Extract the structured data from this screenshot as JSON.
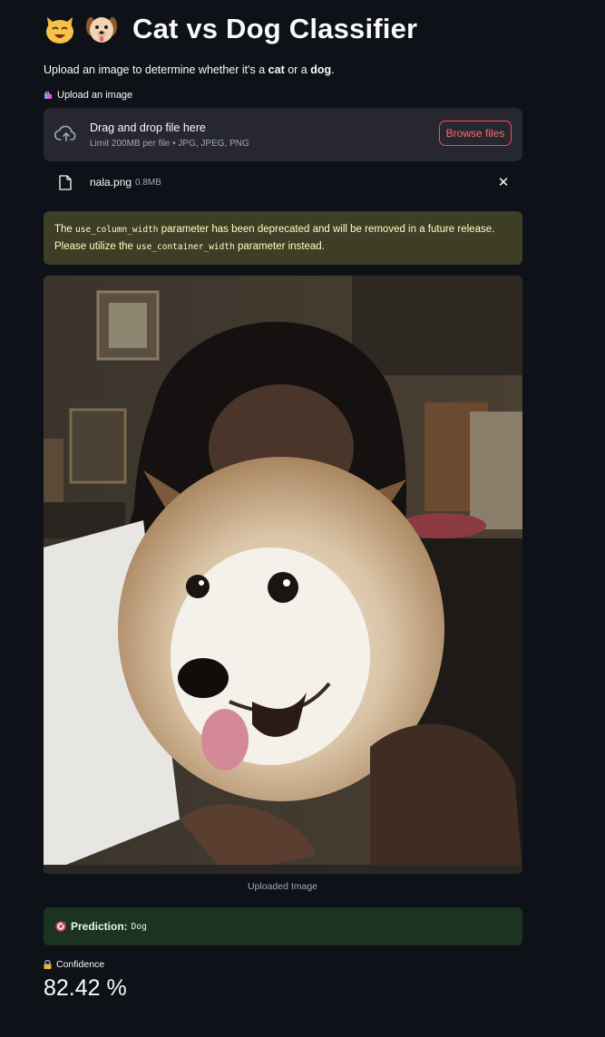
{
  "header": {
    "title": "Cat vs Dog Classifier",
    "subtitle_pre": "Upload an image to determine whether it's a ",
    "subtitle_cat": "cat",
    "subtitle_mid": " or a ",
    "subtitle_dog": "dog",
    "subtitle_end": ".",
    "icons": [
      "cat-face-emoji",
      "dog-face-emoji"
    ]
  },
  "uploader": {
    "label": "Upload an image",
    "label_icon": "shopping-bags-emoji",
    "drop_title": "Drag and drop file here",
    "limit_text": "Limit 200MB per file • JPG, JPEG, PNG",
    "browse_label": "Browse files",
    "icon": "cloud-upload-icon"
  },
  "file": {
    "name": "nala.png",
    "size": "0.8MB",
    "icon": "file-icon",
    "close": "✕"
  },
  "warning": {
    "t1": "The ",
    "c1": "use_column_width",
    "t2": " parameter has been deprecated and will be removed in a future release. Please utilize the ",
    "c2": "use_container_width",
    "t3": " parameter instead."
  },
  "image": {
    "caption": "Uploaded Image"
  },
  "prediction": {
    "icon": "direct-hit-emoji",
    "label": "Prediction:",
    "value": "Dog"
  },
  "confidence": {
    "icon": "lock-emoji",
    "label": "Confidence",
    "value": "82.42 %"
  },
  "colors": {
    "background": "#0e1117",
    "accent": "#ff4b4b",
    "warning_bg": "#3e3d26",
    "success_bg": "#1c3322"
  }
}
